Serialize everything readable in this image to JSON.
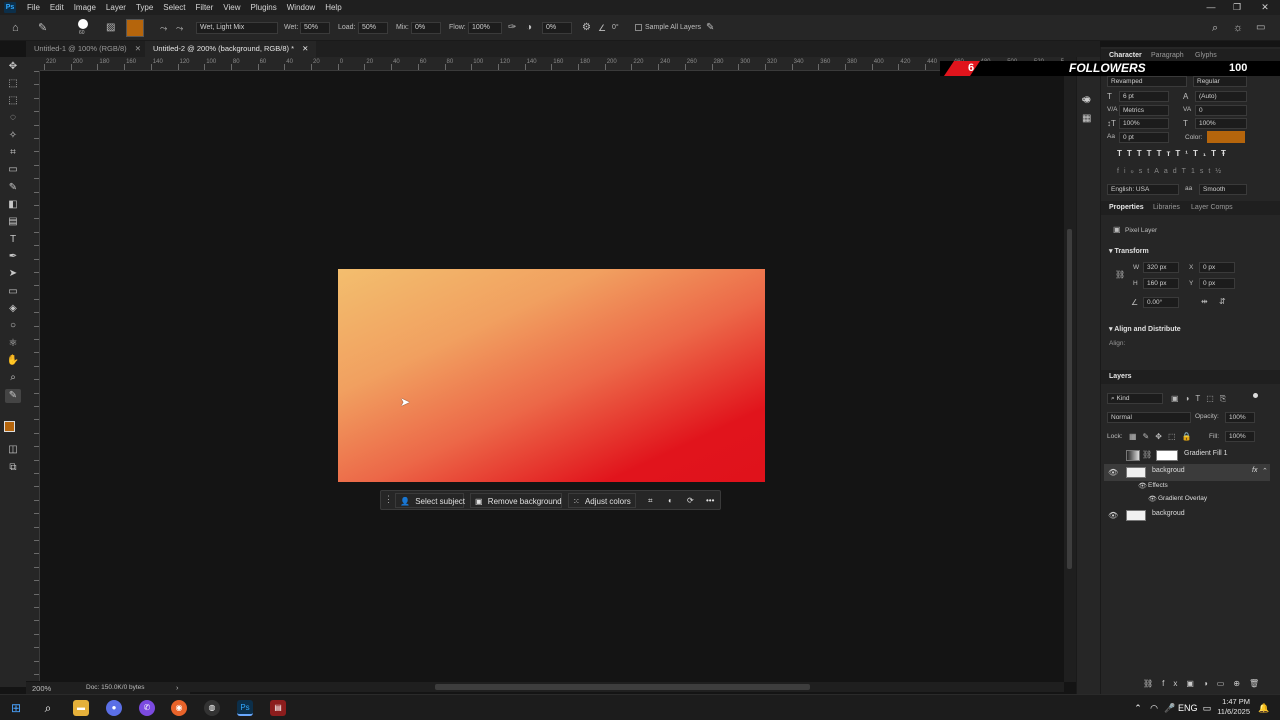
{
  "menubar": {
    "logo": "Ps",
    "items": [
      "File",
      "Edit",
      "Image",
      "Layer",
      "Type",
      "Select",
      "Filter",
      "View",
      "Plugins",
      "Window",
      "Help"
    ]
  },
  "options": {
    "brush_size": "60",
    "blend_preset": "Wet, Light Mix",
    "wet_label": "Wet:",
    "wet_value": "50%",
    "load_label": "Load:",
    "load_value": "50%",
    "mix_label": "Mix:",
    "mix_value": "0%",
    "flow_label": "Flow:",
    "flow_value": "100%",
    "smoothing_value": "0%",
    "angle_value": "0°",
    "sample_all_layers": "Sample All Layers",
    "swatch_color": "#b5650c"
  },
  "tabs": [
    {
      "label": "Untitled-1 @ 100% (RGB/8)",
      "active": false
    },
    {
      "label": "Untitled-2 @ 200% (background, RGB/8) *",
      "active": true
    }
  ],
  "ruler": {
    "h_ticks": [
      "220",
      "200",
      "180",
      "160",
      "140",
      "120",
      "100",
      "80",
      "60",
      "40",
      "20",
      "0",
      "20",
      "40",
      "60",
      "80",
      "100",
      "120",
      "140",
      "160",
      "180",
      "200",
      "220",
      "240",
      "260",
      "280",
      "300",
      "320",
      "340",
      "360",
      "380",
      "400",
      "420",
      "440",
      "460",
      "480",
      "500",
      "520",
      "540"
    ]
  },
  "context_bar": {
    "select_subject": "Select subject",
    "remove_background": "Remove background",
    "adjust_colors": "Adjust colors",
    "more": "•••"
  },
  "status": {
    "zoom": "200%",
    "doc": "Doc: 150.0K/0 bytes"
  },
  "overlay": {
    "count": "6",
    "label": "FOLLOWERS",
    "goal": "100"
  },
  "character": {
    "tabs": [
      "Character",
      "Paragraph",
      "Glyphs"
    ],
    "font_family": "Revamped",
    "font_style": "Regular",
    "font_size": "6 pt",
    "leading": "(Auto)",
    "kerning": "Metrics",
    "tracking": "0",
    "vscale": "100%",
    "hscale": "100%",
    "baseline": "0 pt",
    "color_label": "Color:",
    "color": "#b5650c",
    "language": "English: USA",
    "antialias_label": "aa",
    "antialias": "Smooth",
    "type_buttons": [
      "T",
      "T",
      "TT",
      "Tт",
      "T¹",
      "T₁",
      "T",
      "Ŧ"
    ],
    "opentype_buttons": [
      "fi",
      "ℴ",
      "st",
      "A",
      "ad",
      "T",
      "1st",
      "½"
    ]
  },
  "properties": {
    "tabs": [
      "Properties",
      "Libraries",
      "Layer Comps"
    ],
    "layer_type": "Pixel Layer",
    "transform_title": "Transform",
    "w_label": "W",
    "w_value": "320 px",
    "h_label": "H",
    "h_value": "160 px",
    "x_label": "X",
    "x_value": "0 px",
    "y_label": "Y",
    "y_value": "0 px",
    "angle": "0.00°",
    "align_title": "Align and Distribute",
    "align_label": "Align:"
  },
  "layers": {
    "title": "Layers",
    "filter": "Kind",
    "blend_mode": "Normal",
    "opacity_label": "Opacity:",
    "opacity_value": "100%",
    "lock_label": "Lock:",
    "fill_label": "Fill:",
    "fill_value": "100%",
    "items": [
      {
        "name": "Gradient Fill 1",
        "visible": false
      },
      {
        "name": "backgroud",
        "visible": true,
        "fx": "fx"
      },
      {
        "name": "Effects",
        "visible": true
      },
      {
        "name": "Gradient Overlay",
        "visible": true
      },
      {
        "name": "backgroud",
        "visible": true
      }
    ]
  },
  "taskbar": {
    "lang": "ENG",
    "time": "1:47 PM",
    "date": "11/6/2025"
  }
}
